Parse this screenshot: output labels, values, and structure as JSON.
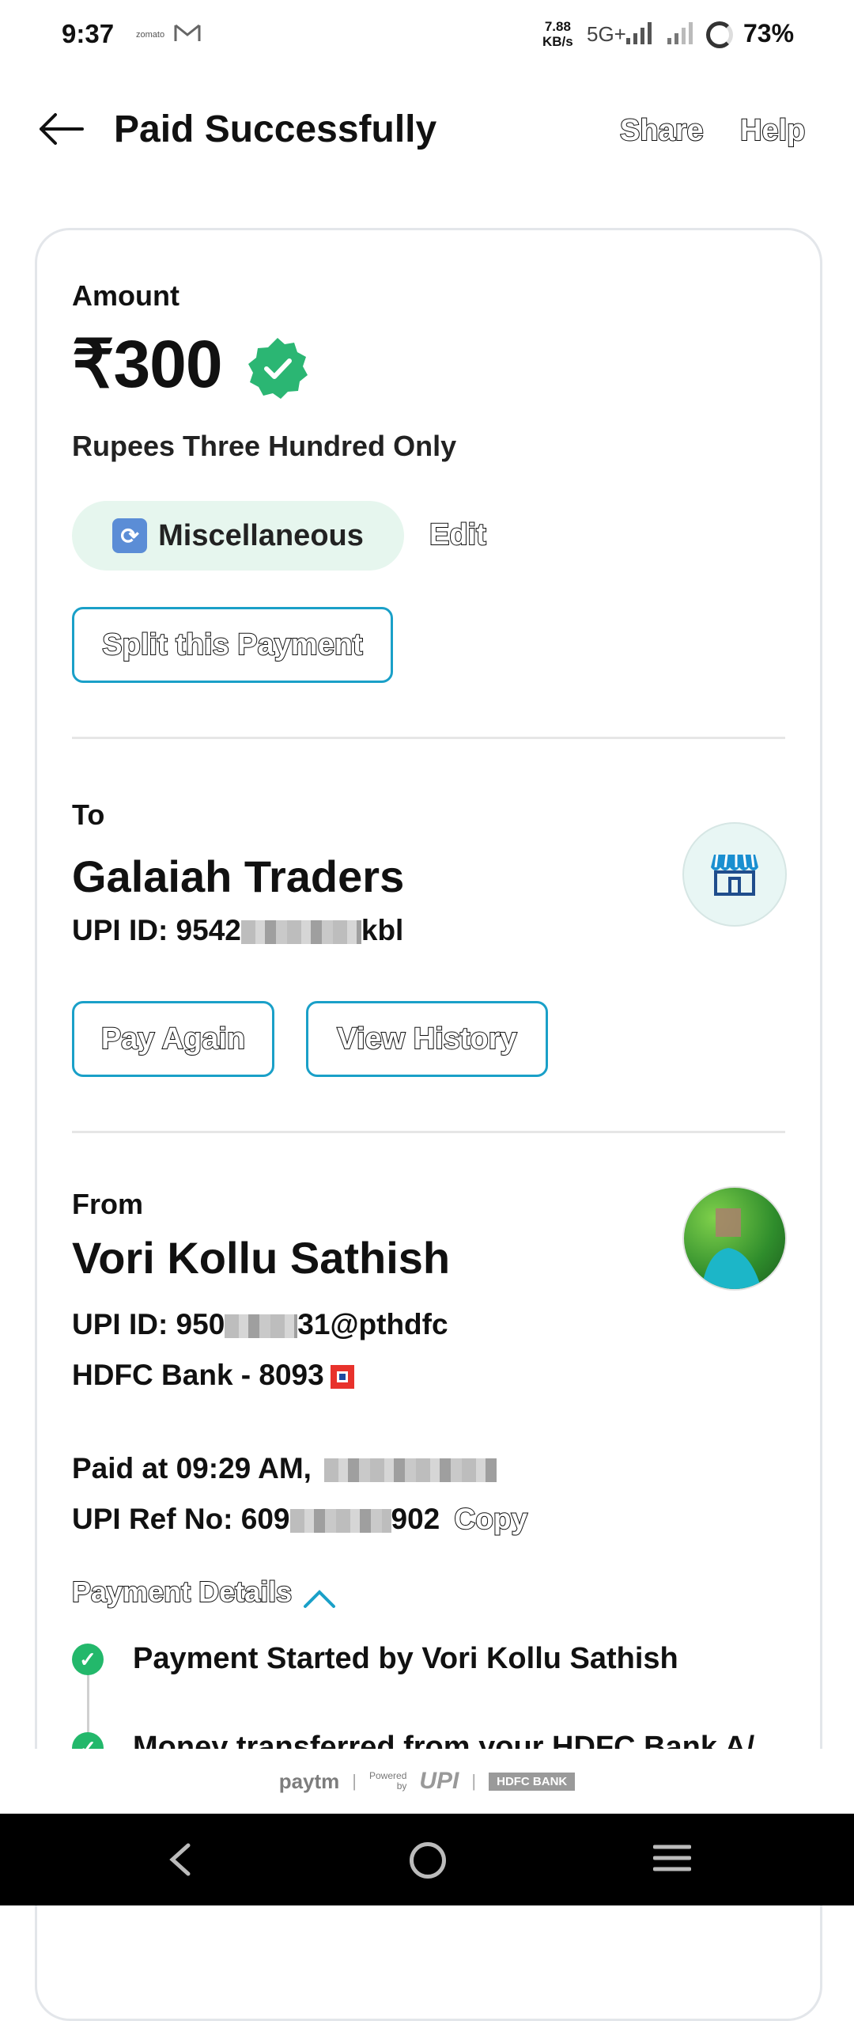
{
  "status_bar": {
    "time": "9:37",
    "notification_app": "zomato",
    "net_speed_value": "7.88",
    "net_speed_unit": "KB/s",
    "network_type": "5G+",
    "battery_percent": "73%"
  },
  "header": {
    "title": "Paid Successfully",
    "share_label": "Share",
    "help_label": "Help"
  },
  "amount": {
    "label": "Amount",
    "value": "₹300",
    "in_words": "Rupees Three Hundred Only",
    "category": "Miscellaneous",
    "edit_label": "Edit",
    "split_label": "Split this Payment"
  },
  "to": {
    "label": "To",
    "name": "Galaiah Traders",
    "upi_prefix": "UPI ID: 9542",
    "upi_suffix": "kbl",
    "pay_again_label": "Pay Again",
    "view_history_label": "View History"
  },
  "from": {
    "label": "From",
    "name": "Vori Kollu Sathish",
    "upi_prefix": "UPI ID: 950",
    "upi_suffix": "31@pthdfc",
    "bank": "HDFC Bank - 8093",
    "paid_at_prefix": "Paid at 09:29 AM,",
    "ref_prefix": "UPI Ref No: 609",
    "ref_suffix": "902",
    "copy_label": "Copy"
  },
  "payment_details": {
    "label": "Payment Details",
    "steps": [
      "Payment Started by Vori Kollu Sathish",
      "Money transferred from your HDFC Bank A/"
    ]
  },
  "footer": {
    "paytm": "paytm",
    "powered_by_line1": "Powered",
    "powered_by_line2": "by",
    "upi": "UPI",
    "bank_badge": "HDFC BANK"
  },
  "colors": {
    "accent_blue": "#1aa0c8",
    "success_green": "#23b86b",
    "tag_bg": "#e6f6ee"
  }
}
